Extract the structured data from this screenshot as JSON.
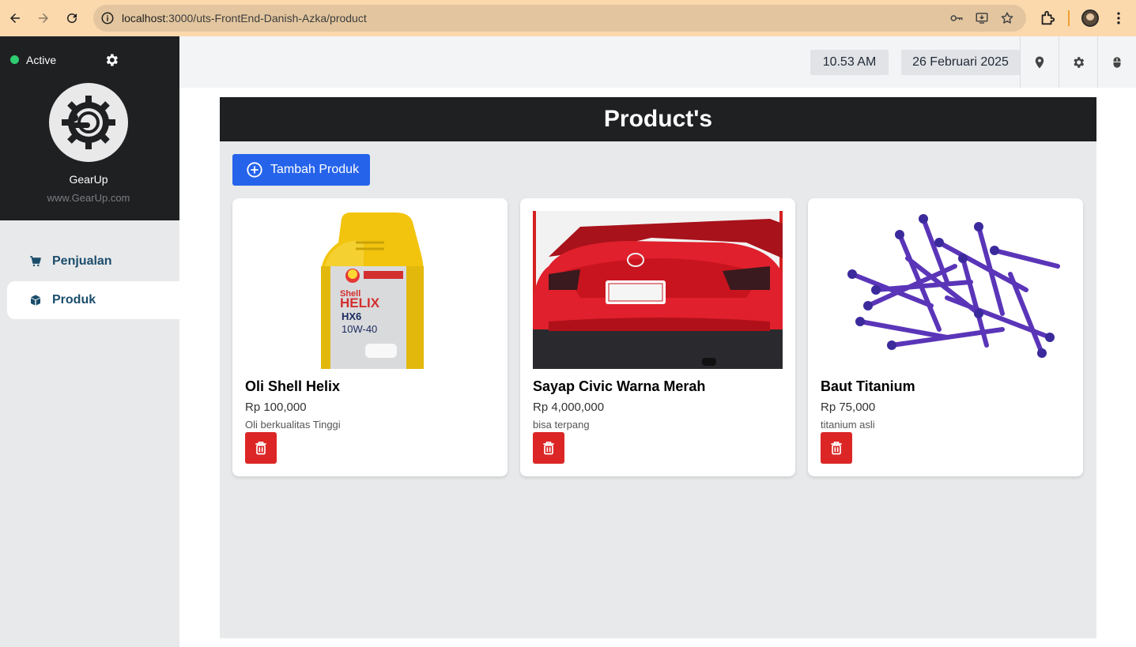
{
  "browser": {
    "url_host": "localhost",
    "url_path": ":3000/uts-FrontEnd-Danish-Azka/product"
  },
  "sidebar": {
    "status": "Active",
    "brand_name": "GearUp",
    "brand_url": "www.GearUp.com",
    "items": [
      {
        "label": "Penjualan",
        "icon": "cart-icon",
        "active": false
      },
      {
        "label": "Produk",
        "icon": "cube-icon",
        "active": true
      }
    ]
  },
  "topbar": {
    "time": "10.53 AM",
    "date": "26 Februari 2025"
  },
  "main": {
    "title": "Product's",
    "add_label": "Tambah Produk"
  },
  "products": [
    {
      "name": "Oli Shell Helix",
      "price": "Rp 100,000",
      "description": "Oli berkualitas Tinggi",
      "image": "motor-oil-bottle"
    },
    {
      "name": "Sayap Civic Warna Merah",
      "price": "Rp 4,000,000",
      "description": "bisa terpang",
      "image": "red-civic-rear-wing"
    },
    {
      "name": "Baut Titanium",
      "price": "Rp 75,000",
      "description": "titanium asli",
      "image": "purple-titanium-bolts"
    }
  ],
  "colors": {
    "accent": "#2563eb",
    "danger": "#dc2626",
    "dark": "#1f2022",
    "status": "#2ecc71",
    "browser_bar": "#fbd9ad"
  }
}
